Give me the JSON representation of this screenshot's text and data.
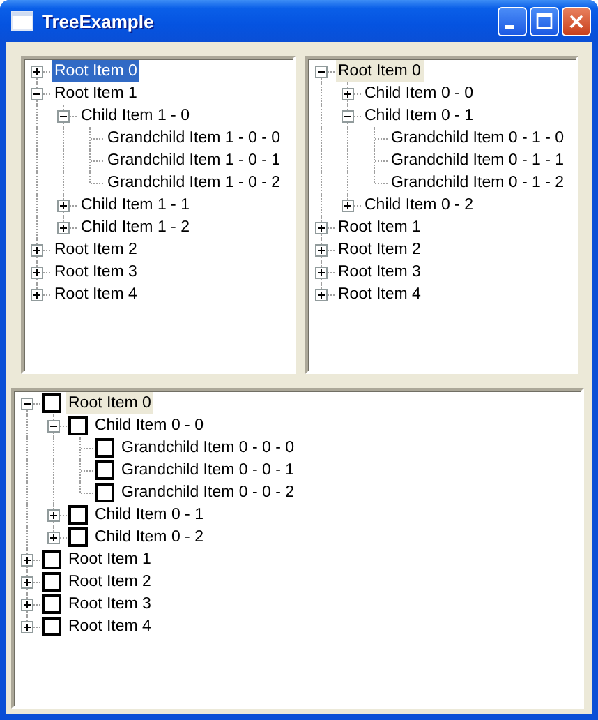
{
  "window": {
    "title": "TreeExample"
  },
  "trees": [
    {
      "focused": true,
      "items": [
        {
          "label": "Root Item 0",
          "expanded": false,
          "selected": true
        },
        {
          "label": "Root Item 1",
          "expanded": true,
          "selected": false,
          "children": [
            {
              "label": "Child Item 1 - 0",
              "expanded": true,
              "selected": false,
              "children": [
                {
                  "label": "Grandchild Item 1 - 0 - 0",
                  "selected": false
                },
                {
                  "label": "Grandchild Item 1 - 0 - 1",
                  "selected": false
                },
                {
                  "label": "Grandchild Item 1 - 0 - 2",
                  "selected": false
                }
              ]
            },
            {
              "label": "Child Item 1 - 1",
              "expanded": false,
              "selected": false
            },
            {
              "label": "Child Item 1 - 2",
              "expanded": false,
              "selected": false
            }
          ]
        },
        {
          "label": "Root Item 2",
          "expanded": false,
          "selected": false
        },
        {
          "label": "Root Item 3",
          "expanded": false,
          "selected": false
        },
        {
          "label": "Root Item 4",
          "expanded": false,
          "selected": false
        }
      ]
    },
    {
      "focused": false,
      "items": [
        {
          "label": "Root Item 0",
          "expanded": true,
          "selected": true,
          "children": [
            {
              "label": "Child Item 0 - 0",
              "expanded": false,
              "selected": false
            },
            {
              "label": "Child Item 0 - 1",
              "expanded": true,
              "selected": false,
              "children": [
                {
                  "label": "Grandchild Item 0 - 1 - 0",
                  "selected": false
                },
                {
                  "label": "Grandchild Item 0 - 1 - 1",
                  "selected": false
                },
                {
                  "label": "Grandchild Item 0 - 1 - 2",
                  "selected": false
                }
              ]
            },
            {
              "label": "Child Item 0 - 2",
              "expanded": false,
              "selected": false
            }
          ]
        },
        {
          "label": "Root Item 1",
          "expanded": false,
          "selected": false
        },
        {
          "label": "Root Item 2",
          "expanded": false,
          "selected": false
        },
        {
          "label": "Root Item 3",
          "expanded": false,
          "selected": false
        },
        {
          "label": "Root Item 4",
          "expanded": false,
          "selected": false
        }
      ]
    },
    {
      "focused": false,
      "items": [
        {
          "label": "Root Item 0",
          "expanded": true,
          "selected": true,
          "checked": false,
          "children": [
            {
              "label": "Child Item 0 - 0",
              "expanded": true,
              "selected": false,
              "checked": false,
              "children": [
                {
                  "label": "Grandchild Item 0 - 0 - 0",
                  "selected": false,
                  "checked": false
                },
                {
                  "label": "Grandchild Item 0 - 0 - 1",
                  "selected": false,
                  "checked": false
                },
                {
                  "label": "Grandchild Item 0 - 0 - 2",
                  "selected": false,
                  "checked": false
                }
              ]
            },
            {
              "label": "Child Item 0 - 1",
              "expanded": false,
              "selected": false,
              "checked": false
            },
            {
              "label": "Child Item 0 - 2",
              "expanded": false,
              "selected": false,
              "checked": false
            }
          ]
        },
        {
          "label": "Root Item 1",
          "expanded": false,
          "selected": false,
          "checked": false
        },
        {
          "label": "Root Item 2",
          "expanded": false,
          "selected": false,
          "checked": false
        },
        {
          "label": "Root Item 3",
          "expanded": false,
          "selected": false,
          "checked": false
        },
        {
          "label": "Root Item 4",
          "expanded": false,
          "selected": false,
          "checked": false
        }
      ]
    }
  ]
}
